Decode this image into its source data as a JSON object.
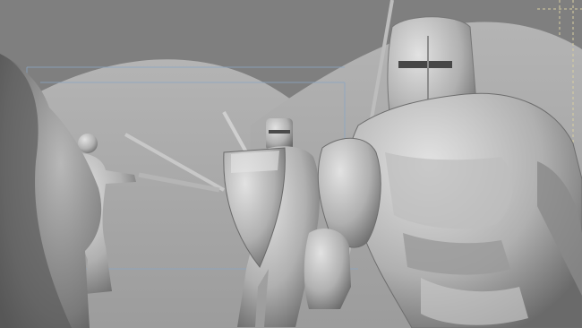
{
  "viewport": {
    "type": "3d-render-preview",
    "shading": "gray-clay",
    "guides": "camera-frame-dashed-lines"
  },
  "scene": {
    "objects": [
      {
        "name": "hill-left",
        "kind": "terrain"
      },
      {
        "name": "hill-right",
        "kind": "terrain"
      },
      {
        "name": "cloaked-figure-foreground-left",
        "kind": "character"
      },
      {
        "name": "swordsman-lunging",
        "kind": "character",
        "weapon": "sword"
      },
      {
        "name": "knight-with-shield",
        "kind": "character",
        "weapon": "sword-and-shield"
      },
      {
        "name": "knight-great-helm-foreground",
        "kind": "character",
        "weapon": "spear"
      }
    ]
  },
  "colors": {
    "background": "#7f7f7f",
    "hill": "#a9a9a9",
    "clay_light": "#cfcfcf",
    "clay_mid": "#a6a6a6",
    "clay_dark": "#555555",
    "guide_line": "#8aa6c4",
    "frame_corner": "#d8cfa0"
  }
}
